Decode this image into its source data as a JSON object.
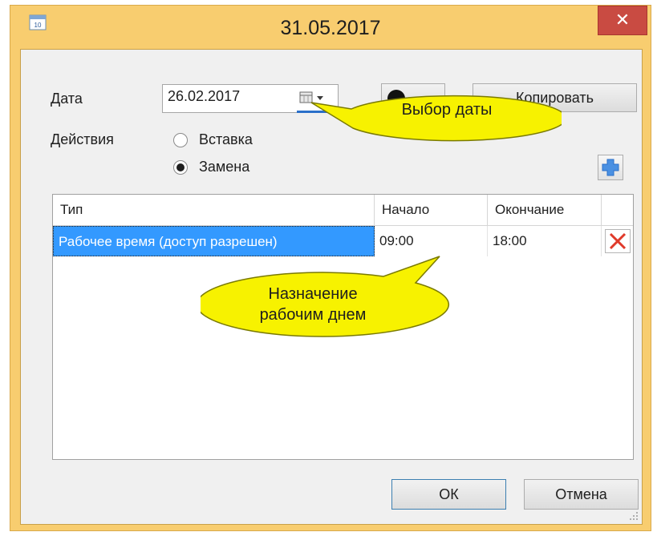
{
  "window": {
    "title": "31.05.2017",
    "close_symbol": "✕",
    "icon": "calendar-icon"
  },
  "form": {
    "date_label": "Дата",
    "date_value": "26.02.2017",
    "actions_label": "Действия",
    "radio_insert": "Вставка",
    "radio_replace": "Замена",
    "selected_action": "Замена",
    "copy_button": "Копировать"
  },
  "grid": {
    "columns": [
      "Тип",
      "Начало",
      "Окончание"
    ],
    "rows": [
      {
        "type": "Рабочее время (доступ разрешен)",
        "start": "09:00",
        "end": "18:00"
      }
    ]
  },
  "callouts": {
    "date_pick": "Выбор даты",
    "workday_line1": "Назначение",
    "workday_line2": "рабочим днем"
  },
  "footer": {
    "ok": "ОК",
    "cancel": "Отмена"
  },
  "colors": {
    "title_bar": "#f8cd6f",
    "close_button": "#c94b42",
    "selection": "#3399ff",
    "callout_fill": "#f7f200",
    "add_icon": "#4a90e2",
    "delete_icon": "#e03a2a"
  }
}
